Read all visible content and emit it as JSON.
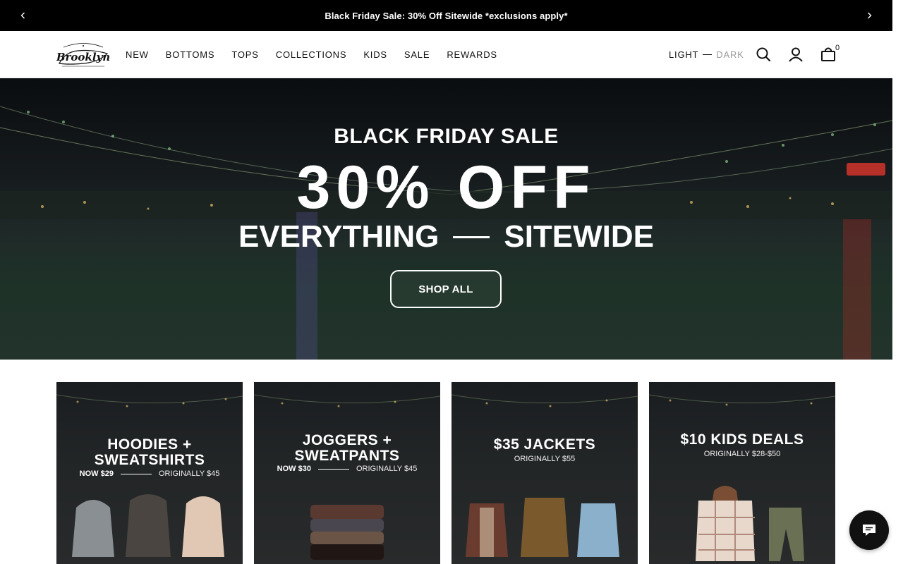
{
  "announcement": {
    "text": "Black Friday Sale: 30% Off Sitewide *exclusions apply*",
    "prev_icon": "chevron-left-icon",
    "next_icon": "chevron-right-icon"
  },
  "header": {
    "logo_alt": "Brooklyn Cloth",
    "nav": [
      "NEW",
      "BOTTOMS",
      "TOPS",
      "COLLECTIONS",
      "KIDS",
      "SALE",
      "REWARDS"
    ],
    "theme": {
      "light": "LIGHT",
      "dark": "DARK"
    },
    "icons": [
      "search-icon",
      "account-icon",
      "cart-icon"
    ],
    "cart_count": "0"
  },
  "hero": {
    "subtitle": "BLACK FRIDAY SALE",
    "headline": "30% OFF",
    "tag_left": "EVERYTHING",
    "tag_right": "SITEWIDE",
    "cta": "SHOP ALL"
  },
  "cards": [
    {
      "title_line1": "HOODIES +",
      "title_line2": "SWEATSHIRTS",
      "now": "NOW $29",
      "original": "ORIGINALLY $45"
    },
    {
      "title_line1": "JOGGERS +",
      "title_line2": "SWEATPANTS",
      "now": "NOW $30",
      "original": "ORIGINALLY $45"
    },
    {
      "title_line1": "$35 JACKETS",
      "title_line2": "",
      "now": "",
      "original": "ORIGINALLY $55"
    },
    {
      "title_line1": "$10 KIDS DEALS",
      "title_line2": "",
      "now": "",
      "original": "ORIGINALLY $28-$50"
    }
  ],
  "chat": {
    "icon": "chat-icon"
  },
  "colors": {
    "announcement_bg": "#000000",
    "text": "#111111",
    "muted": "#999999",
    "white": "#ffffff"
  }
}
